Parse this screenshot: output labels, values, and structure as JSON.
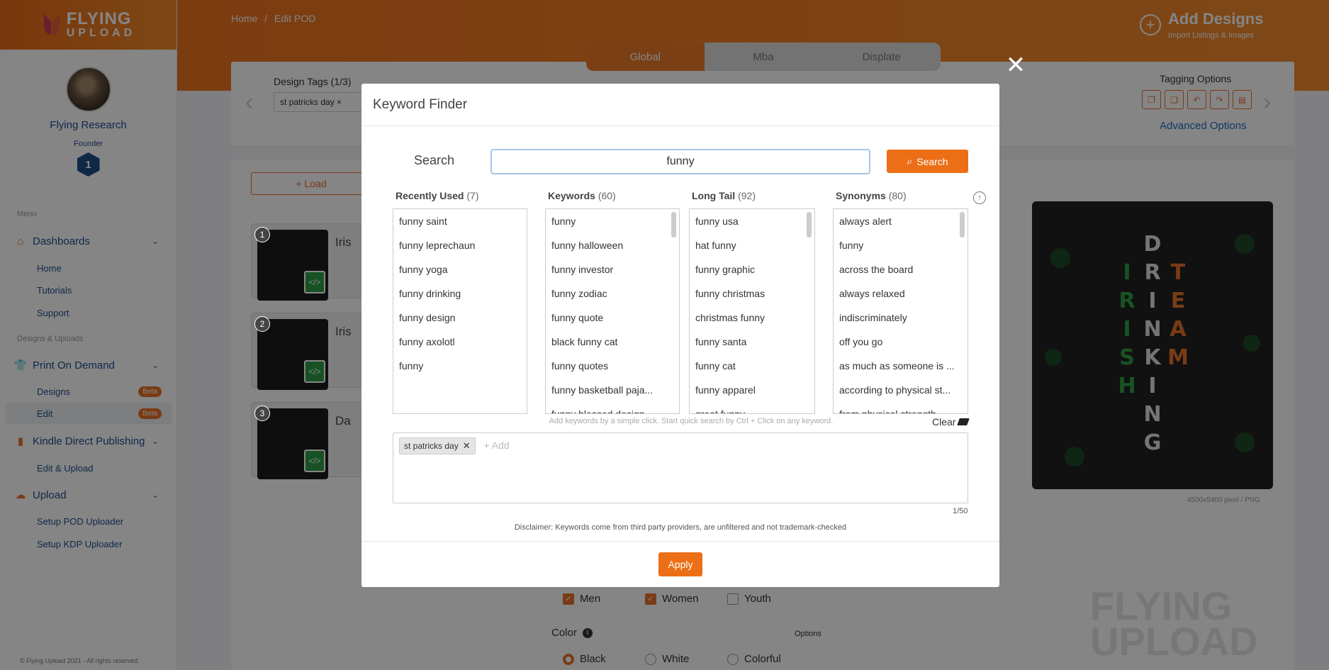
{
  "sidebar": {
    "logo_line1": "FLYING",
    "logo_line2": "UPLOAD",
    "profile_name": "Flying Research",
    "profile_role": "Founder",
    "level": "1",
    "menu_heading": "Menu",
    "designs_heading": "Designs & Uploads",
    "groups": [
      {
        "label": "Dashboards",
        "icon": "home-icon"
      },
      {
        "label": "Print On Demand",
        "icon": "tshirt-icon"
      },
      {
        "label": "Kindle Direct Publishing",
        "icon": "book-icon"
      },
      {
        "label": "Upload",
        "icon": "cloud-upload-icon"
      }
    ],
    "subs": {
      "home": "Home",
      "tutorials": "Tutorials",
      "support": "Support",
      "designs": "Designs",
      "edit": "Edit",
      "kdp_edit": "Edit & Upload",
      "setup_pod": "Setup POD Uploader",
      "setup_kdp": "Setup KDP Uploader"
    },
    "beta": "Beta",
    "copyright": "© Flying Upload 2021 - All rights reserved."
  },
  "header": {
    "breadcrumb_home": "Home",
    "breadcrumb_sep": "/",
    "breadcrumb_current": "Edit POD",
    "add_designs_title": "Add Designs",
    "add_designs_sub": "Import Listings & Images",
    "tabs": [
      "Global",
      "Mba",
      "Displate"
    ]
  },
  "background": {
    "design_tags_label": "Design Tags (1/3)",
    "tag_chip": "st patricks day ×",
    "tagging_options": "Tagging Options",
    "advanced_options": "Advanced Options",
    "load_button": "+ Load",
    "designs": [
      {
        "num": "1",
        "title": "Iris"
      },
      {
        "num": "2",
        "title": "Iris"
      },
      {
        "num": "3",
        "title": "Da"
      }
    ],
    "preview_caption": "4500x5400 pixel / PNG",
    "fit_men": "Men",
    "fit_women": "Women",
    "fit_youth": "Youth",
    "color_label": "Color",
    "options_label": "Options",
    "color_black": "Black",
    "color_white": "White",
    "color_colorful": "Colorful",
    "bg_logo_1": "FLYING",
    "bg_logo_2": "UPLOAD"
  },
  "modal": {
    "title": "Keyword Finder",
    "close": "✕",
    "search_label": "Search",
    "search_value": "funny",
    "search_button": "Search",
    "columns": [
      {
        "title": "Recently Used",
        "count": "(7)",
        "items": [
          "funny saint",
          "funny leprechaun",
          "funny yoga",
          "funny drinking",
          "funny design",
          "funny axolotl",
          "funny"
        ]
      },
      {
        "title": "Keywords",
        "count": "(60)",
        "items": [
          "funny",
          "funny halloween",
          "funny investor",
          "funny zodiac",
          "funny quote",
          "black funny cat",
          "funny quotes",
          "funny basketball paja...",
          "funny blessed design"
        ]
      },
      {
        "title": "Long Tail",
        "count": "(92)",
        "items": [
          "funny usa",
          "hat funny",
          "funny graphic",
          "funny christmas",
          "christmas funny",
          "funny santa",
          "funny cat",
          "funny apparel",
          "great funny"
        ]
      },
      {
        "title": "Synonyms",
        "count": "(80)",
        "items": [
          "always alert",
          "funny",
          "across the board",
          "always relaxed",
          "indiscriminately",
          "off you go",
          "as much as someone is ...",
          "according to physical st...",
          "from physical strength"
        ]
      }
    ],
    "hint": "Add keywords by a simple click. Start quick search by Ctrl + Click on any keyword.",
    "clear_label": "Clear",
    "selected_tags": [
      "st patricks day"
    ],
    "add_placeholder": "+ Add",
    "counter": "1/50",
    "disclaimer": "Disclaimer: Keywords come from third party providers, are unfiltered and not trademark-checked",
    "apply_button": "Apply"
  },
  "colors": {
    "accent": "#ec6f17",
    "link": "#1f4e8c"
  }
}
